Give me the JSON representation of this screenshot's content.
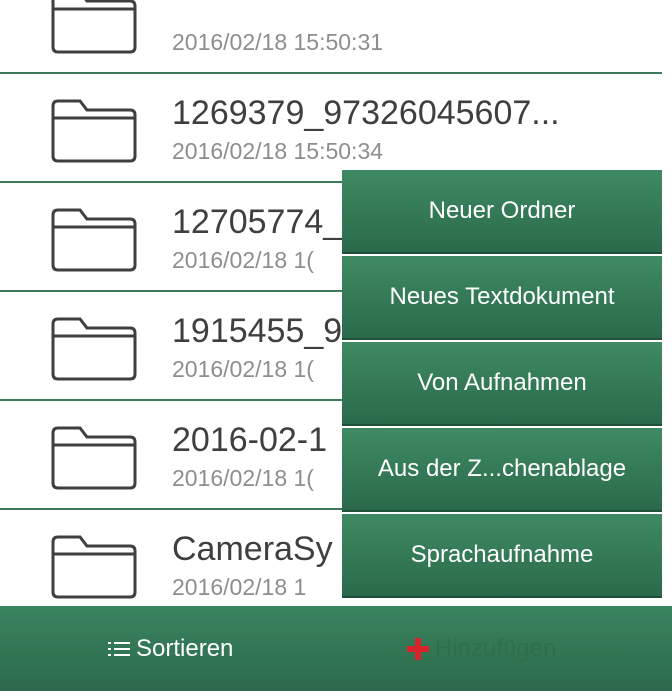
{
  "files": [
    {
      "name": "",
      "date": "2016/02/18 15:50:31"
    },
    {
      "name": "1269379_97326045607...",
      "date": "2016/02/18 15:50:34"
    },
    {
      "name": "12705774_",
      "date": "2016/02/18 1("
    },
    {
      "name": "1915455_9",
      "date": "2016/02/18 1("
    },
    {
      "name": "2016-02-1",
      "date": "2016/02/18 1("
    },
    {
      "name": "CameraSy",
      "date": "2016/02/18 1"
    }
  ],
  "menu": {
    "items": [
      "Neuer Ordner",
      "Neues Textdokument",
      "Von Aufnahmen",
      "Aus der Z...chenablage",
      "Sprachaufnahme"
    ]
  },
  "toolbar": {
    "sort_label": "Sortieren",
    "add_label": "Hinzufügen"
  },
  "colors": {
    "accent_green": "#2f7652",
    "separator_green": "#3e7a59",
    "add_plus_red": "#d8232a"
  },
  "icons": {
    "folder": "folder-icon",
    "sort": "list-icon",
    "add": "plus-icon"
  }
}
